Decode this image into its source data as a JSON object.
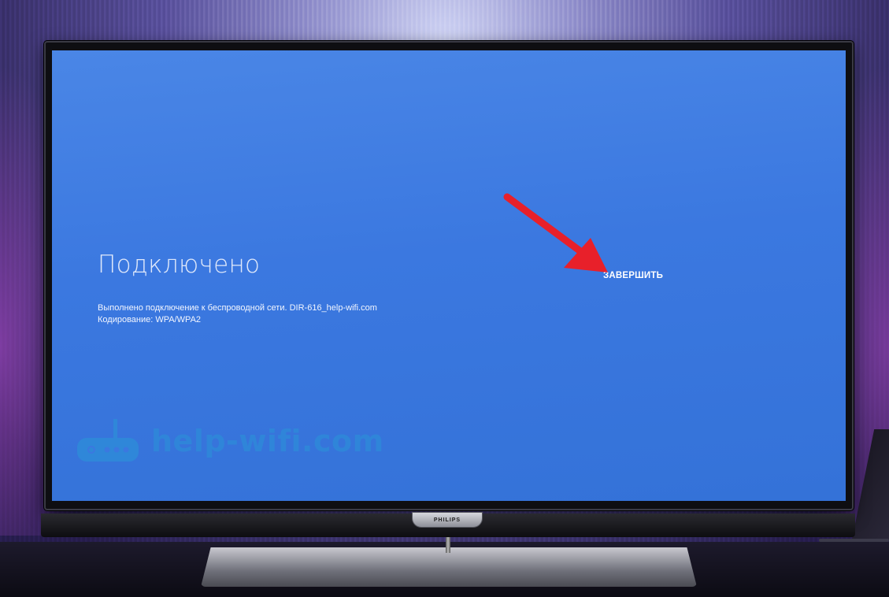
{
  "screen": {
    "title": "Подключено",
    "description_line_1": "Выполнено подключение к беспроводной сети. DIR-616_help-wifi.com",
    "description_line_2": "Кодирование: WPA/WPA2",
    "finish_button_label": "ЗАВЕРШИТЬ"
  },
  "watermark": {
    "text": "help-wifi.com",
    "icon": "router-icon"
  },
  "tv": {
    "brand": "PHILIPS"
  },
  "annotation": {
    "icon": "arrow-icon",
    "color": "#e8202a"
  },
  "colors": {
    "screen_background": "#3b78e0",
    "watermark": "#2f87d9"
  }
}
